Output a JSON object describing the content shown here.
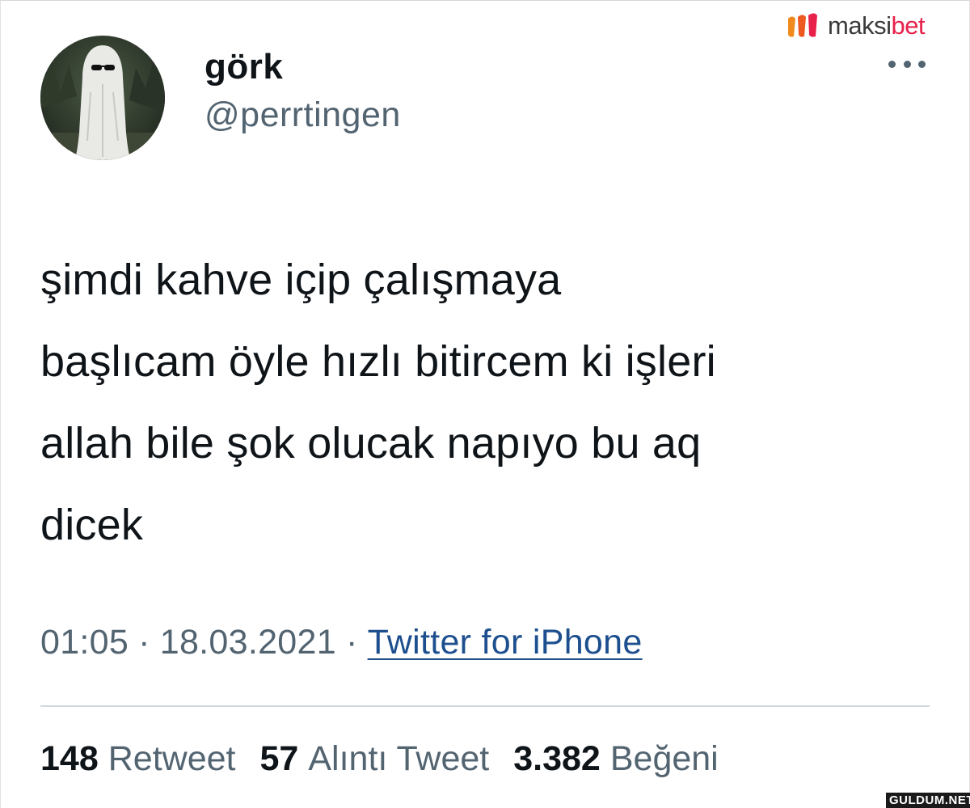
{
  "watermark_top": {
    "text_a": "maksi",
    "text_b": "bet",
    "accent": "#e8214a"
  },
  "author": {
    "display_name": "görk",
    "handle": "@perrtingen",
    "avatar": "ghost-costume-avatar"
  },
  "tweet": {
    "lines": [
      "şimdi kahve içip çalışmaya",
      "başlıcam öyle hızlı bitircem ki işleri",
      "allah bile şok olucak napıyo bu aq",
      "dicek"
    ]
  },
  "meta": {
    "time": "01:05",
    "separator": "·",
    "date": "18.03.2021",
    "source": "Twitter for iPhone"
  },
  "stats": [
    {
      "count": "148",
      "label": "Retweet"
    },
    {
      "count": "57",
      "label": "Alıntı Tweet"
    },
    {
      "count": "3.382",
      "label": "Beğeni"
    }
  ],
  "watermark_bottom": "GULDUM.NET",
  "colors": {
    "text": "#0f1419",
    "secondary": "#536471",
    "link": "#1d4f8f",
    "divider": "#cfd9de"
  }
}
